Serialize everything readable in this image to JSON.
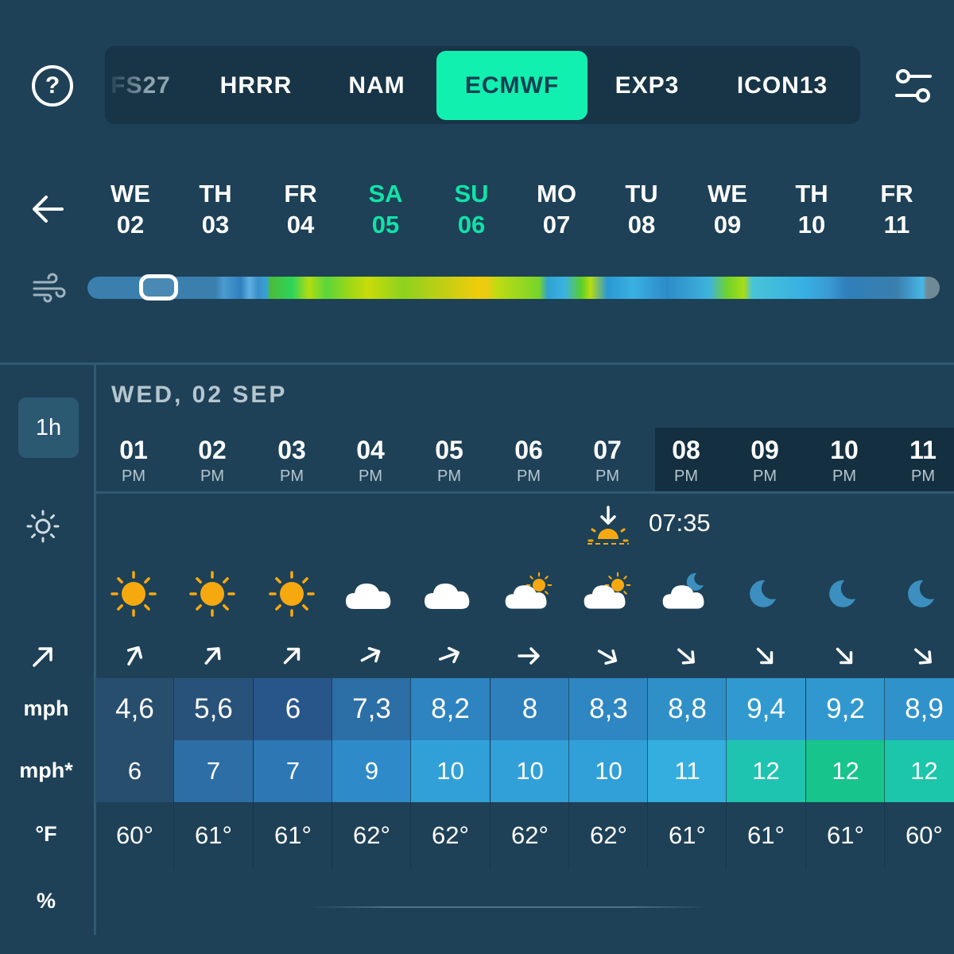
{
  "models": [
    {
      "label": "FS27",
      "state": "faded"
    },
    {
      "label": "HRRR",
      "state": "normal"
    },
    {
      "label": "NAM",
      "state": "normal"
    },
    {
      "label": "ECMWF",
      "state": "active"
    },
    {
      "label": "EXP3",
      "state": "normal"
    },
    {
      "label": "ICON13",
      "state": "normal"
    }
  ],
  "help_label": "?",
  "days": [
    {
      "dow": "WE",
      "num": "02",
      "weekend": false
    },
    {
      "dow": "TH",
      "num": "03",
      "weekend": false
    },
    {
      "dow": "FR",
      "num": "04",
      "weekend": false
    },
    {
      "dow": "SA",
      "num": "05",
      "weekend": true
    },
    {
      "dow": "SU",
      "num": "06",
      "weekend": true
    },
    {
      "dow": "MO",
      "num": "07",
      "weekend": false
    },
    {
      "dow": "TU",
      "num": "08",
      "weekend": false
    },
    {
      "dow": "WE",
      "num": "09",
      "weekend": false
    },
    {
      "dow": "TH",
      "num": "10",
      "weekend": false
    },
    {
      "dow": "FR",
      "num": "11",
      "weekend": false
    }
  ],
  "timeline": {
    "position_fraction": 0.08
  },
  "interval_label": "1h",
  "row_labels": {
    "speed": "mph",
    "gust": "mph*",
    "temp": "°F",
    "precip": "%"
  },
  "date_title": "WED, 02 SEP",
  "sunset": {
    "time": "07:35",
    "icon": "sunset-icon"
  },
  "colors": {
    "accent": "#12f0b0",
    "background": "#1e4157",
    "sun": "#f6a90f",
    "moon": "#3c8fbe"
  },
  "hours": [
    {
      "h": "01",
      "ap": "PM",
      "night": false,
      "weather": "sun",
      "arrow_deg": 30,
      "speed": "4,6",
      "gust": "6",
      "temp": "60°",
      "speed_bg": "#284e6e",
      "gust_bg": "#284e6e"
    },
    {
      "h": "02",
      "ap": "PM",
      "night": false,
      "weather": "sun",
      "arrow_deg": 40,
      "speed": "5,6",
      "gust": "7",
      "temp": "61°",
      "speed_bg": "#29527a",
      "gust_bg": "#2d6ea6"
    },
    {
      "h": "03",
      "ap": "PM",
      "night": false,
      "weather": "sun",
      "arrow_deg": 45,
      "speed": "6",
      "gust": "7",
      "temp": "61°",
      "speed_bg": "#29568a",
      "gust_bg": "#2d78b4"
    },
    {
      "h": "04",
      "ap": "PM",
      "night": false,
      "weather": "cloud",
      "arrow_deg": 62,
      "speed": "7,3",
      "gust": "9",
      "temp": "62°",
      "speed_bg": "#2c6ea6",
      "gust_bg": "#2e8ac8"
    },
    {
      "h": "05",
      "ap": "PM",
      "night": false,
      "weather": "cloud",
      "arrow_deg": 70,
      "speed": "8,2",
      "gust": "10",
      "temp": "62°",
      "speed_bg": "#2e84c0",
      "gust_bg": "#31a0d8"
    },
    {
      "h": "06",
      "ap": "PM",
      "night": false,
      "weather": "partly-sun",
      "arrow_deg": 90,
      "speed": "8",
      "gust": "10",
      "temp": "62°",
      "speed_bg": "#2e80bc",
      "gust_bg": "#31a0d8"
    },
    {
      "h": "07",
      "ap": "PM",
      "night": false,
      "weather": "partly-sun",
      "arrow_deg": 120,
      "speed": "8,3",
      "gust": "10",
      "temp": "62°",
      "speed_bg": "#2e86c2",
      "gust_bg": "#31a0d8"
    },
    {
      "h": "08",
      "ap": "PM",
      "night": true,
      "weather": "partly-moon",
      "arrow_deg": 130,
      "speed": "8,8",
      "gust": "11",
      "temp": "61°",
      "speed_bg": "#2f90c8",
      "gust_bg": "#33aedf"
    },
    {
      "h": "09",
      "ap": "PM",
      "night": true,
      "weather": "moon",
      "arrow_deg": 135,
      "speed": "9,4",
      "gust": "12",
      "temp": "61°",
      "speed_bg": "#309ad0",
      "gust_bg": "#1ec4b0"
    },
    {
      "h": "10",
      "ap": "PM",
      "night": true,
      "weather": "moon",
      "arrow_deg": 135,
      "speed": "9,2",
      "gust": "12",
      "temp": "61°",
      "speed_bg": "#3098ce",
      "gust_bg": "#16c48c"
    },
    {
      "h": "11",
      "ap": "PM",
      "night": true,
      "weather": "moon",
      "arrow_deg": 130,
      "speed": "8,9",
      "gust": "12",
      "temp": "60°",
      "speed_bg": "#2f92ca",
      "gust_bg": "#1cc6aa"
    }
  ]
}
